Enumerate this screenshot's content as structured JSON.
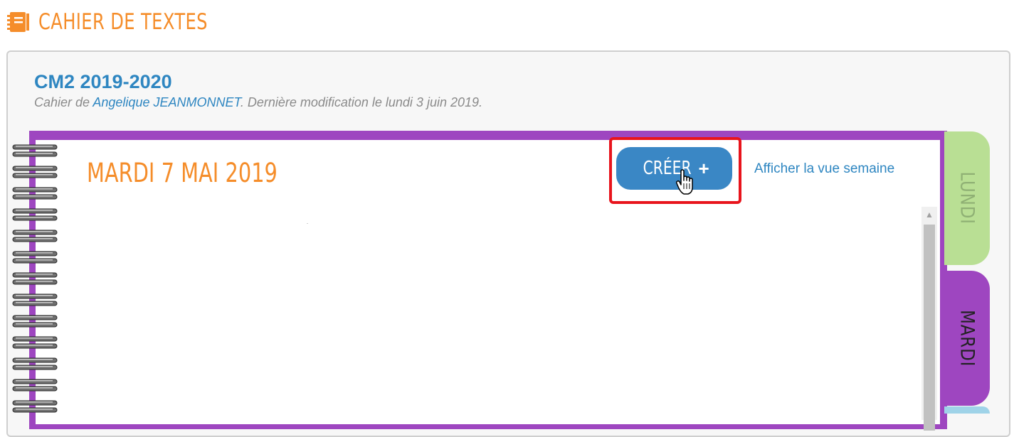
{
  "header": {
    "title": "CAHIER DE TEXTES",
    "icon": "notebook-icon",
    "accent_color": "#f58d2a"
  },
  "notebook": {
    "title": "CM2 2019-2020",
    "subtitle_prefix": "Cahier de ",
    "author": "Angelique JEANMONNET",
    "subtitle_suffix": ". Dernière modification le lundi 3 juin 2019."
  },
  "page": {
    "day_heading": "MARDI 7 MAI 2019",
    "create_button_label": "CRÉER",
    "create_button_icon": "plus-icon",
    "week_view_link": "Afficher la vue semaine"
  },
  "tabs": [
    {
      "label": "LUNDI",
      "color": "#b9df94",
      "active": false
    },
    {
      "label": "MARDI",
      "color": "#9e46c0",
      "active": true
    }
  ],
  "colors": {
    "primary_blue": "#3a87c5",
    "notebook_purple": "#9e46c0",
    "highlight_red": "#e8141c"
  }
}
